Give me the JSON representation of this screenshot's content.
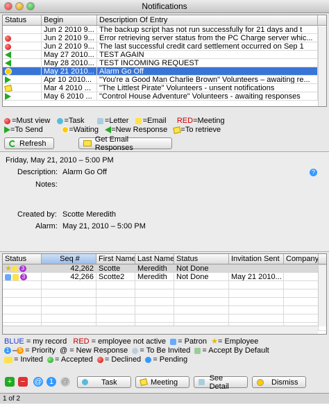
{
  "window": {
    "title": "Notifications"
  },
  "notifications": {
    "columns": [
      "Status",
      "Begin",
      "Description Of Entry"
    ],
    "rows": [
      {
        "status": "none",
        "begin": "Jun 2 2010 9...",
        "desc": "The backup script has not run successfully for 21 days and t",
        "selected": false
      },
      {
        "status": "red",
        "begin": "Jun 2 2010 9...",
        "desc": "Error retrieving server status from the PC Charge server whic...",
        "selected": false
      },
      {
        "status": "red",
        "begin": "Jun 2 2010 9...",
        "desc": "The last successful credit card settlement occurred on Sep 1",
        "selected": false
      },
      {
        "status": "arrow-left",
        "begin": "May 27 2010...",
        "desc": "TEST AGAIN",
        "selected": false
      },
      {
        "status": "arrow-left",
        "begin": "May 28 2010...",
        "desc": "TEST INCOMING REQUEST",
        "selected": false
      },
      {
        "status": "clock",
        "begin": "May 21 2010...",
        "desc": "Alarm Go Off",
        "selected": true
      },
      {
        "status": "arrow-right",
        "begin": "Apr 10 2010...",
        "desc": "\"You're a Good Man Charlie Brown\" Volunteers – awaiting re...",
        "selected": false
      },
      {
        "status": "note",
        "begin": "Mar 4 2010 ...",
        "desc": "\"The Littlest Pirate\" Volunteers - unsent notifications",
        "selected": false
      },
      {
        "status": "arrow-right",
        "begin": "May 6 2010 ...",
        "desc": "\"Control House Adventure\" Volunteers - awaiting responses",
        "selected": false
      }
    ]
  },
  "legend1": {
    "must_view": "=Must view",
    "task": "=Task",
    "letter": "=Letter",
    "email": "=Email",
    "red": "RED",
    "meeting": "=Meeting",
    "to_send": "=To Send",
    "waiting": "=Waiting",
    "new_response": "=New Response",
    "to_retrieve": "=To retrieve"
  },
  "buttons1": {
    "refresh": "Refresh",
    "get_email": "Get Email Responses"
  },
  "detail": {
    "date_line": "Friday, May 21, 2010 – 5:00 PM",
    "description_label": "Description:",
    "description_value": "Alarm Go Off",
    "notes_label": "Notes:",
    "created_by_label": "Created by:",
    "created_by_value": "Scotte Meredith",
    "alarm_label": "Alarm:",
    "alarm_value": "May 21, 2010 – 5:00 PM"
  },
  "people": {
    "columns": [
      "Status",
      "Seq #",
      "First Name",
      "Last Name",
      "Status",
      "Invitation Sent",
      "Company"
    ],
    "rows": [
      {
        "seq": "42,262",
        "first": "Scotte",
        "last": "Meredith",
        "status": "Not Done",
        "invitation": "",
        "company": "",
        "badge": "3"
      },
      {
        "seq": "42,266",
        "first": "Scotte2",
        "last": "Meredith",
        "status": "Not Done",
        "invitation": "May 21 2010...",
        "company": "",
        "badge": "3"
      }
    ]
  },
  "legend2": {
    "blue": "BLUE",
    "my_record": "= my record",
    "red": "RED",
    "not_active": "= employee not active",
    "patron": "= Patron",
    "employee": "= Employee",
    "priority": "= Priority",
    "at": "@",
    "new_response": "= New Response",
    "to_be_invited": "= To Be Invited",
    "accept_default": "= Accept By Default",
    "invited": "= Invited",
    "accepted": "= Accepted",
    "declined": "= Declined",
    "pending": "= Pending"
  },
  "buttons2": {
    "task": "Task",
    "meeting": "Meeting",
    "see_detail": "See Detail",
    "dismiss": "Dismiss"
  },
  "footer": {
    "page": "1 of 2"
  },
  "colors": {
    "selection": "#3875d7",
    "blue_text": "#1f3fd8",
    "red_text": "#cc0000"
  }
}
